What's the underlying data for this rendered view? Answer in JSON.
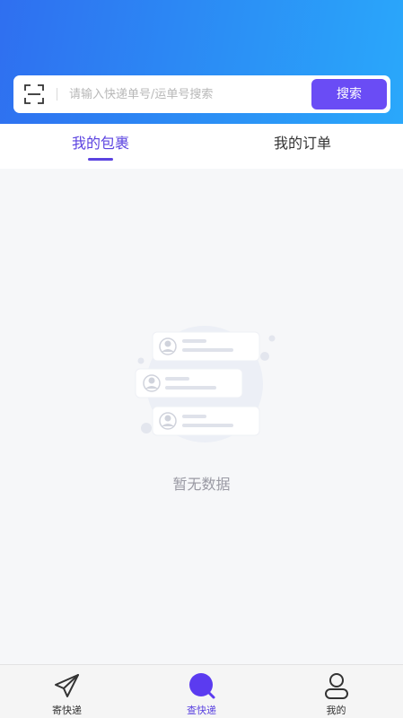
{
  "search": {
    "placeholder": "请输入快递单号/运单号搜索",
    "button_label": "搜索",
    "scan_icon": "scan-icon"
  },
  "tabs": [
    {
      "label": "我的包裹",
      "active": true
    },
    {
      "label": "我的订单",
      "active": false
    }
  ],
  "empty_state": {
    "text": "暂无数据",
    "icon": "empty-list-illustration"
  },
  "tabbar": [
    {
      "label": "寄快递",
      "icon": "paper-plane-icon",
      "active": false
    },
    {
      "label": "查快递",
      "icon": "search-icon",
      "active": true
    },
    {
      "label": "我的",
      "icon": "user-icon",
      "active": false
    }
  ],
  "colors": {
    "header_start": "#2f6ff0",
    "header_end": "#2aa8fb",
    "accent": "#6a4cf5",
    "active_text": "#5b43e0"
  }
}
